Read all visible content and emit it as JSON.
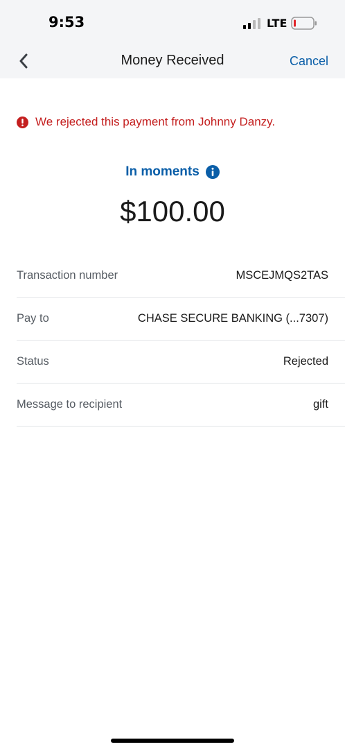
{
  "status_bar": {
    "time": "9:53",
    "network": "LTE"
  },
  "nav": {
    "title": "Money Received",
    "cancel_label": "Cancel",
    "back_icon": "chevron-left-icon"
  },
  "alert": {
    "icon": "error-icon",
    "message": "We rejected this payment from Johnny Danzy.",
    "color": "#c41f1f"
  },
  "transfer": {
    "timing": "In moments",
    "info_icon": "info-icon",
    "amount": "$100.00"
  },
  "details": [
    {
      "label": "Transaction number",
      "value": "MSCEJMQS2TAS"
    },
    {
      "label": "Pay to",
      "value": "CHASE SECURE BANKING (...7307)"
    },
    {
      "label": "Status",
      "value": "Rejected"
    },
    {
      "label": "Message to recipient",
      "value": "gift"
    }
  ],
  "colors": {
    "accent": "#0a5ea8",
    "error": "#c41f1f",
    "header_bg": "#f4f5f7"
  }
}
